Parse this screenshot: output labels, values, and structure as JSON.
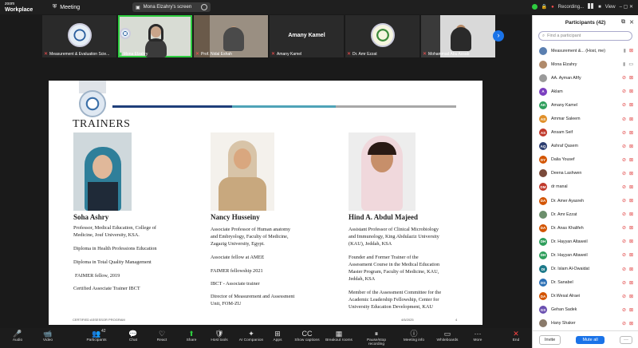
{
  "app": {
    "brand_line1": "zoom",
    "brand_line2": "Workplace",
    "meeting_label": "Meeting"
  },
  "share_banner": {
    "label": "Mona Elzahry's screen"
  },
  "status": {
    "recording": "Recording...",
    "view": "View"
  },
  "thumbnails": [
    {
      "name": "Measurement & Evaluation Scie...",
      "muted": true,
      "kind": "emblem"
    },
    {
      "name": "Mona Elzahry",
      "muted": false,
      "kind": "video-woman",
      "active": true
    },
    {
      "name": "Prof. Nidal Eshah",
      "muted": true,
      "kind": "video-man"
    },
    {
      "name": "Amany Kamel",
      "center_name": "Amany Kamel",
      "muted": true,
      "kind": "name"
    },
    {
      "name": "Dr. Amr Ezzat",
      "muted": true,
      "kind": "emblem-green"
    },
    {
      "name": "Mohammad Abu Assab",
      "muted": true,
      "kind": "video-man2"
    }
  ],
  "slide": {
    "heading": "TRAINERS",
    "trainers": [
      {
        "name": "Soha Ashry",
        "lines": [
          "Professor, Medical Education, College of",
          "Medicine, Jouf University, KSA.",
          "",
          "Diploma in Health Professions Education",
          "",
          "Diploma in Total Quality Management",
          "",
          "FAIMER fellow, 2019",
          "",
          "Certified Associate Trainer IBCT"
        ]
      },
      {
        "name": "Nancy Husseiny",
        "lines": [
          "Associate Professor of Human anatomy",
          "and Embryology, Faculty of Medicine,",
          "Zagazig University, Egypt.",
          "",
          "Associate fellow at AMEE",
          "",
          "FAIMER fellowship 2021",
          "",
          "IBCT - Associate trainer",
          "",
          "Director of Measurement and Assessment",
          "Unit, FOM-ZU"
        ]
      },
      {
        "name": "Hind A. Abdul Majeed",
        "lines": [
          "Assistant Professor of Clinical Microbiology",
          "and Immunology, King Abdulaziz University",
          "(KAU), Jeddah, KSA",
          "",
          "Founder and Former Trainer of the",
          "Assessment Course in the Medical Education",
          "Master Program, Faculty of Medicine, KAU,",
          "Jeddah, KSA",
          "",
          "Member of the Assessment Committee for the",
          "Academic Leadership Fellowship, Center for",
          "University Education Development, KAU"
        ]
      }
    ],
    "footer_left": "CERTIFIED ASSESSOR PROGRAM",
    "footer_date": "4/5/2025",
    "footer_page": "4"
  },
  "participants": {
    "title": "Participants (42)",
    "search_placeholder": "Find a participant",
    "list": [
      {
        "initials": "",
        "name": "Measurement &... (Host, me)",
        "color": "#5a7fb0",
        "mic": "on",
        "cam": "off"
      },
      {
        "initials": "",
        "name": "Mona Elzahry",
        "color": "#b08a6a",
        "mic": "on",
        "cam": "on"
      },
      {
        "initials": "",
        "name": "AA. Ayman Afify",
        "color": "#9a9a9a",
        "mic": "off",
        "cam": "off"
      },
      {
        "initials": "A",
        "name": "Aklam",
        "color": "#7b3fbf",
        "mic": "off",
        "cam": "off"
      },
      {
        "initials": "AK",
        "name": "Amany Kamel",
        "color": "#2e9e5b",
        "mic": "off",
        "cam": "off"
      },
      {
        "initials": "AS",
        "name": "Ammar Saleem",
        "color": "#e0902a",
        "mic": "off",
        "cam": "off"
      },
      {
        "initials": "AS",
        "name": "Ansam Seif",
        "color": "#c0392b",
        "mic": "off",
        "cam": "off"
      },
      {
        "initials": "AQ",
        "name": "Ashraf Qasem",
        "color": "#2c3e70",
        "mic": "off",
        "cam": "off"
      },
      {
        "initials": "DY",
        "name": "Dalia Yousef",
        "color": "#d35400",
        "mic": "off",
        "cam": "off"
      },
      {
        "initials": "",
        "name": "Deena Lashwen",
        "color": "#7a4a3a",
        "mic": "off",
        "cam": "off"
      },
      {
        "initials": "DM",
        "name": "dr manal",
        "color": "#c0392b",
        "mic": "off",
        "cam": "off"
      },
      {
        "initials": "DA",
        "name": "Dr. Amer Ayasreh",
        "color": "#d35400",
        "mic": "off",
        "cam": "off"
      },
      {
        "initials": "",
        "name": "Dr. Amr Ezzat",
        "color": "#6b8e6b",
        "mic": "off",
        "cam": "off"
      },
      {
        "initials": "DA",
        "name": "Dr. Anas Khalifeh",
        "color": "#d35400",
        "mic": "off",
        "cam": "off"
      },
      {
        "initials": "DH",
        "name": "Dr. Hayyan Altaweil",
        "color": "#2e9e5b",
        "mic": "off",
        "cam": "off"
      },
      {
        "initials": "DH",
        "name": "Dr. Hayyan Altaweil",
        "color": "#2e9e5b",
        "mic": "off",
        "cam": "off"
      },
      {
        "initials": "DI",
        "name": "Dr. Islam Al-Owaidat",
        "color": "#1e7a8a",
        "mic": "off",
        "cam": "off"
      },
      {
        "initials": "DS",
        "name": "Dr. Sanabel",
        "color": "#2a6fb5",
        "mic": "off",
        "cam": "off"
      },
      {
        "initials": "DA",
        "name": "Dr.Wesal Alraei",
        "color": "#d35400",
        "mic": "off",
        "cam": "off"
      },
      {
        "initials": "GS",
        "name": "Gehan Sadek",
        "color": "#6a4fb0",
        "mic": "off",
        "cam": "off"
      },
      {
        "initials": "",
        "name": "Hany Shaker",
        "color": "#8a7a6a",
        "mic": "off",
        "cam": "off"
      }
    ],
    "invite_label": "Invite",
    "mute_all_label": "Mute all",
    "more_label": "···"
  },
  "toolbar": [
    {
      "id": "audio",
      "label": "Audio",
      "glyph": "🎤",
      "state": "slashed"
    },
    {
      "id": "video",
      "label": "Video",
      "glyph": "📹",
      "state": "slashed"
    },
    {
      "id": "participants",
      "label": "Participants",
      "glyph": "👥",
      "badge": "42"
    },
    {
      "id": "chat",
      "label": "Chat",
      "glyph": "💬"
    },
    {
      "id": "react",
      "label": "React",
      "glyph": "♡"
    },
    {
      "id": "share",
      "label": "Share",
      "glyph": "⬆",
      "state": "share"
    },
    {
      "id": "hosttools",
      "label": "Host tools",
      "glyph": "🛡"
    },
    {
      "id": "ai",
      "label": "AI Companion",
      "glyph": "✦"
    },
    {
      "id": "apps",
      "label": "Apps",
      "glyph": "⊞"
    },
    {
      "id": "captions",
      "label": "Show captions",
      "glyph": "CC"
    },
    {
      "id": "breakout",
      "label": "Breakout rooms",
      "glyph": "▦"
    },
    {
      "id": "recording",
      "label": "Pause/stop recording",
      "glyph": "⏸"
    },
    {
      "id": "info",
      "label": "Meeting info",
      "glyph": "ⓘ"
    },
    {
      "id": "whiteboards",
      "label": "Whiteboards",
      "glyph": "▭"
    },
    {
      "id": "more",
      "label": "More",
      "glyph": "···"
    },
    {
      "id": "end",
      "label": "End",
      "glyph": "✕",
      "state": "end"
    }
  ],
  "colors": {
    "accent": "#1a73e8",
    "active_green": "#2ecc40",
    "muted_red": "#e04040",
    "slide_line_navy": "#1f3f7a",
    "slide_line_teal": "#4fa3b8",
    "slide_line_grey": "#a8a8a8"
  }
}
